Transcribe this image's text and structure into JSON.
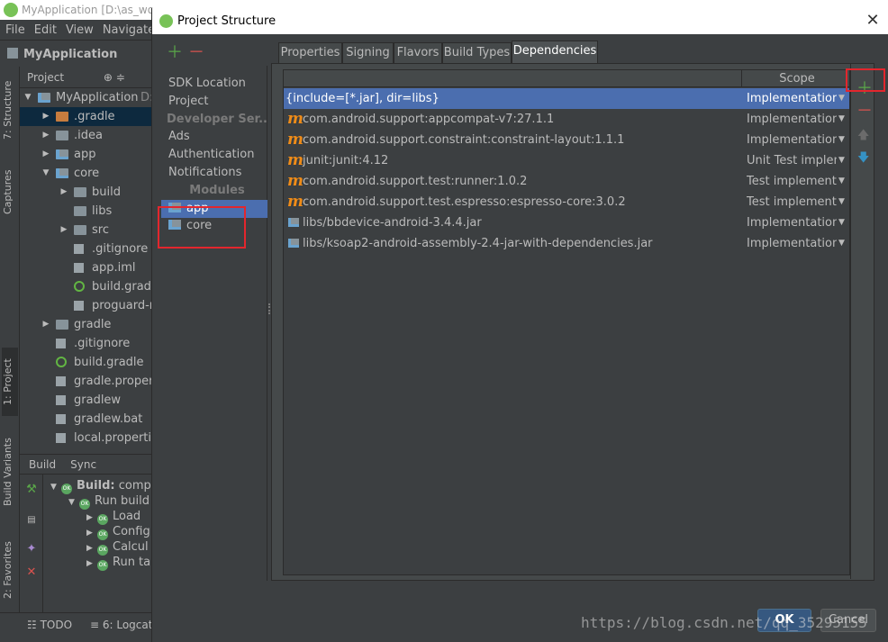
{
  "ide": {
    "window_title": "MyApplication [D:\\as_wo",
    "menu": [
      "File",
      "Edit",
      "View",
      "Navigate"
    ],
    "nav_project": "MyApplication",
    "project_view_label": "Project",
    "side_tabs": [
      "7: Structure",
      "Captures",
      "1: Project",
      "Build Variants",
      "2: Favorites"
    ],
    "tree": [
      {
        "label": "MyApplication",
        "suffix": "D:",
        "icon": "module",
        "arrow": "▼",
        "level": 0
      },
      {
        "label": ".gradle",
        "icon": "folder-orange",
        "arrow": "▶",
        "level": 1,
        "selected": true
      },
      {
        "label": ".idea",
        "icon": "folder",
        "arrow": "▶",
        "level": 1
      },
      {
        "label": "app",
        "icon": "module",
        "arrow": "▶",
        "level": 1
      },
      {
        "label": "core",
        "icon": "module",
        "arrow": "▼",
        "level": 1
      },
      {
        "label": "build",
        "icon": "folder",
        "arrow": "▶",
        "level": 2
      },
      {
        "label": "libs",
        "icon": "folder",
        "arrow": "",
        "level": 2
      },
      {
        "label": "src",
        "icon": "folder",
        "arrow": "▶",
        "level": 2
      },
      {
        "label": ".gitignore",
        "icon": "file",
        "arrow": "",
        "level": 2
      },
      {
        "label": "app.iml",
        "icon": "file",
        "arrow": "",
        "level": 2
      },
      {
        "label": "build.gradle",
        "icon": "gradle",
        "arrow": "",
        "level": 2
      },
      {
        "label": "proguard-r",
        "icon": "file",
        "arrow": "",
        "level": 2
      },
      {
        "label": "gradle",
        "icon": "folder",
        "arrow": "▶",
        "level": 1
      },
      {
        "label": ".gitignore",
        "icon": "file",
        "arrow": "",
        "level": 1
      },
      {
        "label": "build.gradle",
        "icon": "gradle",
        "arrow": "",
        "level": 1
      },
      {
        "label": "gradle.propert",
        "icon": "file",
        "arrow": "",
        "level": 1
      },
      {
        "label": "gradlew",
        "icon": "file",
        "arrow": "",
        "level": 1
      },
      {
        "label": "gradlew.bat",
        "icon": "file",
        "arrow": "",
        "level": 1
      },
      {
        "label": "local.propertie",
        "icon": "file",
        "arrow": "",
        "level": 1
      }
    ],
    "build_tabs": [
      "Build",
      "Sync"
    ],
    "build_tree": [
      {
        "label": "Build:",
        "extra": " compl",
        "level": 0,
        "arrow": "▼",
        "bold": true
      },
      {
        "label": "Run build",
        "extra": "",
        "level": 1,
        "arrow": "▼"
      },
      {
        "label": "Load",
        "extra": "",
        "level": 2,
        "arrow": "▶"
      },
      {
        "label": "Config",
        "extra": "",
        "level": 2,
        "arrow": "▶"
      },
      {
        "label": "Calcul",
        "extra": "",
        "level": 2,
        "arrow": "▶"
      },
      {
        "label": "Run ta",
        "extra": "",
        "level": 2,
        "arrow": "▶"
      }
    ],
    "status_todo": "TODO",
    "status_logcat": "6: Logcat"
  },
  "dialog": {
    "title": "Project Structure",
    "side_items": [
      {
        "label": "SDK Location",
        "type": "item"
      },
      {
        "label": "Project",
        "type": "item"
      },
      {
        "label": "Developer Ser...",
        "type": "header"
      },
      {
        "label": "Ads",
        "type": "item"
      },
      {
        "label": "Authentication",
        "type": "item"
      },
      {
        "label": "Notifications",
        "type": "item"
      },
      {
        "label": "Modules",
        "type": "header"
      },
      {
        "label": "app",
        "type": "module",
        "selected": true
      },
      {
        "label": "core",
        "type": "module"
      }
    ],
    "tabs": [
      "Properties",
      "Signing",
      "Flavors",
      "Build Types",
      "Dependencies"
    ],
    "active_tab": "Dependencies",
    "scope_header": "Scope",
    "dependencies": [
      {
        "name": "{include=[*.jar], dir=libs}",
        "scope": "Implementation",
        "icon": "none",
        "selected": true
      },
      {
        "name": "com.android.support:appcompat-v7:27.1.1",
        "scope": "Implementation",
        "icon": "maven"
      },
      {
        "name": "com.android.support.constraint:constraint-layout:1.1.1",
        "scope": "Implementation",
        "icon": "maven"
      },
      {
        "name": "junit:junit:4.12",
        "scope": "Unit Test implem...",
        "icon": "maven"
      },
      {
        "name": "com.android.support.test:runner:1.0.2",
        "scope": "Test implementat...",
        "icon": "maven"
      },
      {
        "name": "com.android.support.test.espresso:espresso-core:3.0.2",
        "scope": "Test implementat...",
        "icon": "maven"
      },
      {
        "name": "libs/bbdevice-android-3.4.4.jar",
        "scope": "Implementation",
        "icon": "jar"
      },
      {
        "name": "libs/ksoap2-android-assembly-2.4-jar-with-dependencies.jar",
        "scope": "Implementation",
        "icon": "jar"
      }
    ],
    "ok_label": "OK",
    "cancel_label": "Cancel"
  },
  "watermark": "https://blog.csdn.net/qq_35295155",
  "colors": {
    "selection": "#4b6eaf",
    "add_green": "#5aa649",
    "remove_red": "#d9534f",
    "maven_orange": "#f08c18",
    "highlight_box": "#e3262d"
  }
}
